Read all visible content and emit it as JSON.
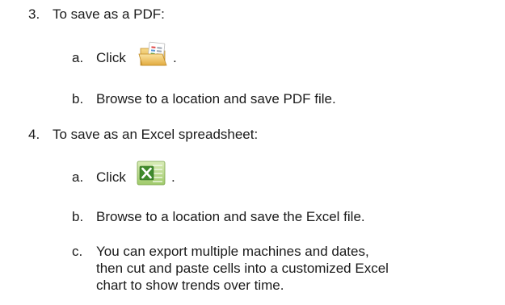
{
  "steps": [
    {
      "number": "3.",
      "text": "To save as a PDF:",
      "substeps": [
        {
          "letter": "a.",
          "text": "Click",
          "suffix": ".",
          "icon": "folder-pdf-icon"
        },
        {
          "letter": "b.",
          "text": "Browse to a location and save PDF file."
        }
      ]
    },
    {
      "number": "4.",
      "text": "To save as an Excel spreadsheet:",
      "substeps": [
        {
          "letter": "a.",
          "text": "Click",
          "suffix": ".",
          "icon": "excel-export-icon"
        },
        {
          "letter": "b.",
          "text": "Browse to a location and save the Excel file."
        },
        {
          "letter": "c.",
          "lines": [
            "You can export multiple machines and dates,",
            "then cut and paste cells into a customized Excel",
            "chart to show trends over time."
          ]
        }
      ]
    }
  ]
}
